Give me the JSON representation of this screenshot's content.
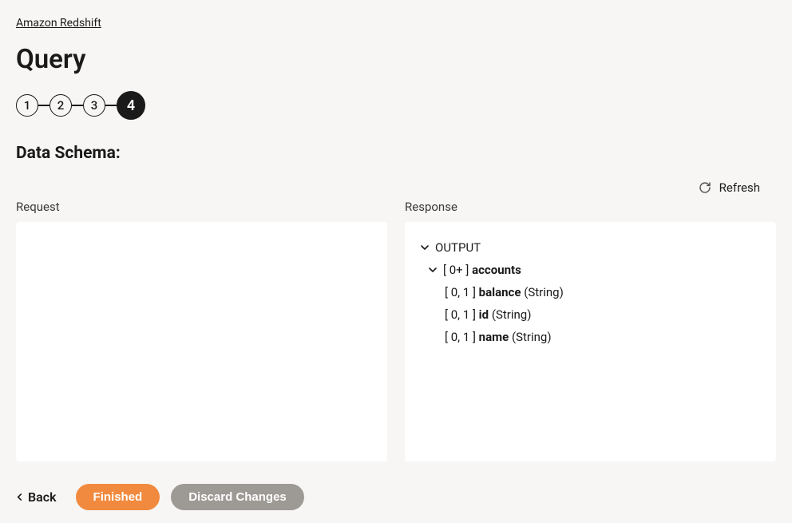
{
  "breadcrumb": "Amazon Redshift",
  "page_title": "Query",
  "stepper": {
    "steps": [
      "1",
      "2",
      "3",
      "4"
    ],
    "active_index": 3
  },
  "schema_label": "Data Schema:",
  "refresh_label": "Refresh",
  "request_label": "Request",
  "response_label": "Response",
  "response_tree": {
    "root_label": "OUTPUT",
    "group": {
      "cardinality": "[ 0+ ]",
      "name": "accounts",
      "fields": [
        {
          "cardinality": "[ 0, 1 ]",
          "name": "balance",
          "type": "(String)"
        },
        {
          "cardinality": "[ 0, 1 ]",
          "name": "id",
          "type": "(String)"
        },
        {
          "cardinality": "[ 0, 1 ]",
          "name": "name",
          "type": "(String)"
        }
      ]
    }
  },
  "footer": {
    "back": "Back",
    "finished": "Finished",
    "discard": "Discard Changes"
  }
}
